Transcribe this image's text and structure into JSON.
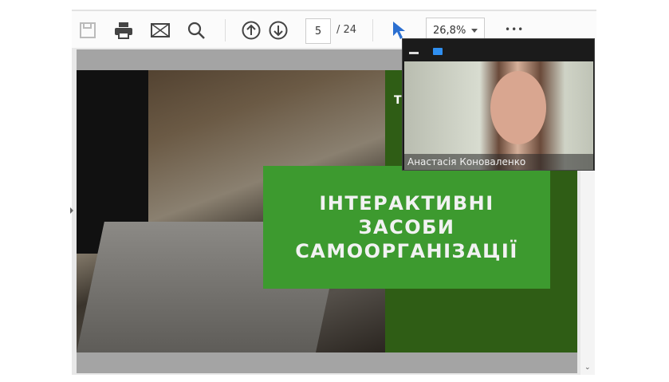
{
  "toolbar": {
    "current_page": "5",
    "page_total": "/ 24",
    "zoom": "26,8%",
    "more": "•••"
  },
  "slide": {
    "title_lines": [
      "ІНТЕРАКТИВНІ",
      "ЗАСОБИ",
      "САМООРГАНІЗАЦІЇ"
    ],
    "partial_text": "Т"
  },
  "video": {
    "participant_name": "Анастасія Коноваленко"
  },
  "colors": {
    "accent": "#2f8ff0",
    "slide_green": "#3d9a2f",
    "slide_dark_green": "#2f5d15"
  }
}
